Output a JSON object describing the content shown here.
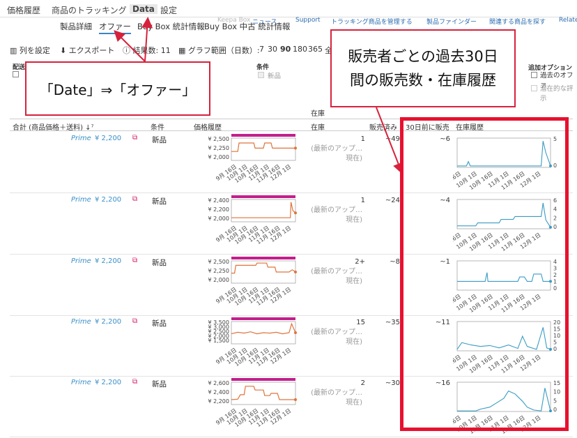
{
  "top_tabs": [
    "価格履歴",
    "商品のトラッキング",
    "Data",
    "設定"
  ],
  "sub_tabs": [
    "製品詳細",
    "オファー",
    "Buy Box 統計情報",
    "Buy Box 中古 統計情報"
  ],
  "links": [
    "Keepa Box",
    "ニュース",
    "Support",
    "トラッキング商品を管理する",
    "製品ファインダー",
    "関連する商品を探す",
    "Relate"
  ],
  "toolbar": {
    "columns": "列を設定",
    "export": "エクスポート",
    "results": "結果数: 11",
    "range_label": "グラフ範囲（日数）:",
    "ranges": [
      "7",
      "30",
      "90",
      "180",
      "365"
    ],
    "all": "全期"
  },
  "filters": {
    "left": "配送",
    "condition_title": "条件",
    "condition_new": "新品",
    "extra_title": "追加オプション",
    "extra_past": "過去のオファ",
    "extra_latent": "潜在的な評",
    "extra_latent2": "示"
  },
  "stock_section": "在庫",
  "headers": {
    "total": "合計 (商品価格＋送料)",
    "condition": "条件",
    "price_history": "価格履歴",
    "stock": "在庫",
    "sold": "販売済み",
    "sold30": "30日前に販売",
    "stock_history": "在庫履歴"
  },
  "callouts": {
    "left": "「Date」⇒「オファー」",
    "right": "販売者ごとの過去30日間の販売数・在庫履歴"
  },
  "x_ticks": [
    "9月 16日",
    "10月 1日",
    "10月 16日",
    "11月 1日",
    "11月 16日",
    "12月 1日"
  ],
  "rows": [
    {
      "prime": "Prime",
      "price": "¥ 2,200",
      "condition": "新品",
      "stock_text": "(最新のアップ…",
      "stock_now": "現在)",
      "stock_count": "1",
      "sold": "~49",
      "sold30": "~6",
      "price_axis": [
        "¥ 2,500",
        "¥ 2,250",
        "¥ 2,000"
      ],
      "stock_axis": [
        "5",
        "0"
      ]
    },
    {
      "prime": "Prime",
      "price": "¥ 2,200",
      "condition": "新品",
      "stock_text": "(最新のアップ…",
      "stock_now": "現在)",
      "stock_count": "1",
      "sold": "~24",
      "sold30": "~4",
      "price_axis": [
        "¥ 2,400",
        "¥ 2,200",
        "¥ 2,000"
      ],
      "stock_axis": [
        "6",
        "4",
        "2",
        "0"
      ]
    },
    {
      "prime": "Prime",
      "price": "¥ 2,200",
      "condition": "新品",
      "stock_text": "(最新のアップ…",
      "stock_now": "現在)",
      "stock_count": "2+",
      "sold": "~8",
      "sold30": "~1",
      "price_axis": [
        "¥ 2,500",
        "¥ 2,250",
        "¥ 2,000"
      ],
      "stock_axis": [
        "4",
        "3",
        "2",
        "1",
        "0"
      ]
    },
    {
      "prime": "Prime",
      "price": "¥ 2,200",
      "condition": "新品",
      "stock_text": "(最新のアップ…",
      "stock_now": "現在)",
      "stock_count": "15",
      "sold": "~35",
      "sold30": "~11",
      "price_axis": [
        "¥ 3,500",
        "¥ 3,000",
        "¥ 2,500",
        "¥ 2,000",
        "¥ 1,500"
      ],
      "stock_axis": [
        "20",
        "15",
        "10",
        "5",
        "0"
      ]
    },
    {
      "prime": "Prime",
      "price": "¥ 2,200",
      "condition": "新品",
      "stock_text": "(最新のアップ…",
      "stock_now": "現在)",
      "stock_count": "2",
      "sold": "~30",
      "sold30": "~16",
      "price_axis": [
        "¥ 2,600",
        "¥ 2,400",
        "¥ 2,200"
      ],
      "stock_axis": [
        "15",
        "10",
        "5",
        "0"
      ]
    }
  ],
  "colors": {
    "price_line": "#e0733a",
    "stock_line": "#3a9cc4",
    "buybox_bar": "#c41e8c",
    "highlight": "#e8102f",
    "callout": "#d6223c"
  }
}
